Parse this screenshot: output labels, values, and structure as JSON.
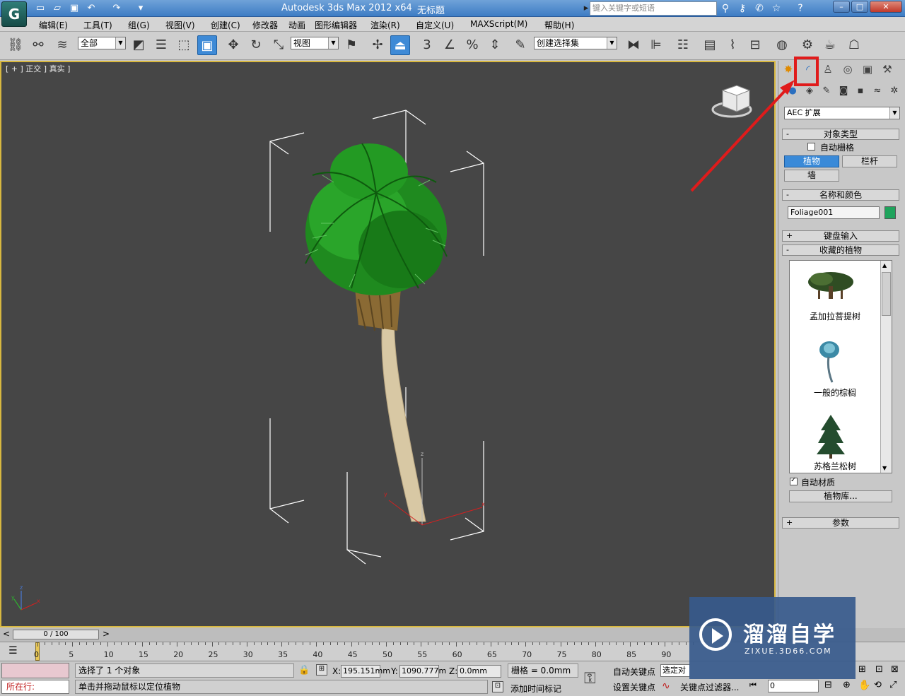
{
  "titlebar": {
    "app_title": "Autodesk 3ds Max  2012 x64",
    "doc_title": "无标题",
    "help_search_placeholder": "键入关键字或短语",
    "minimize": "–",
    "maximize": "□",
    "close": "✕"
  },
  "menubar": {
    "items": [
      "编辑(E)",
      "工具(T)",
      "组(G)",
      "视图(V)",
      "创建(C)",
      "修改器",
      "动画",
      "图形编辑器",
      "渲染(R)",
      "自定义(U)",
      "MAXScript(M)",
      "帮助(H)"
    ]
  },
  "toolbar": {
    "selection_filter": "全部",
    "ref_coord": "视图",
    "named_selection": "创建选择集",
    "snap_label": "3",
    "percent_label": "%"
  },
  "viewport": {
    "label": "[ + ] 正交 ] 真实 ]"
  },
  "command_panel": {
    "category": "AEC 扩展",
    "object_type": {
      "title": "对象类型",
      "autogrid_label": "自动栅格",
      "autogrid_checked": false,
      "buttons": [
        "植物",
        "栏杆",
        "墙"
      ],
      "active_button": "植物"
    },
    "name_color": {
      "title": "名称和颜色",
      "name": "Foliage001",
      "color": "#1fa35c"
    },
    "keyboard_entry": "键盘输入",
    "favorite_plants": {
      "title": "收藏的植物",
      "items": [
        "孟加拉菩提树",
        "一般的棕榈",
        "苏格兰松树"
      ]
    },
    "auto_material_label": "自动材质",
    "auto_material_checked": true,
    "plant_library_button": "植物库...",
    "parameters": "参数",
    "rollout_plus": "+",
    "rollout_minus": "-"
  },
  "timeline": {
    "slider_label": "0 / 100",
    "prev_arrow": "<",
    "next_arrow": ">",
    "ticks": [
      "0",
      "5",
      "10",
      "15",
      "20",
      "25",
      "30",
      "35",
      "40",
      "45",
      "50",
      "55",
      "60",
      "65",
      "70",
      "75",
      "80",
      "85",
      "90"
    ]
  },
  "status": {
    "script_label": "所在行:",
    "selection_info": "选择了 1 个对象",
    "prompt": "单击并拖动鼠标以定位植物",
    "x_label": "X:",
    "x_value": "195.151mm",
    "y_label": "Y:",
    "y_value": "1090.777m",
    "z_label": "Z:",
    "z_value": "0.0mm",
    "grid": "栅格 = 0.0mm",
    "add_time_tag": "添加时间标记",
    "auto_key": "自动关键点",
    "set_key": "设置关键点",
    "selected_dd": "选定对",
    "key_filters": "关键点过滤器...",
    "frame_value": "0"
  },
  "watermark": {
    "title": "溜溜自学",
    "subtitle": "ZIXUE.3D66.COM"
  }
}
